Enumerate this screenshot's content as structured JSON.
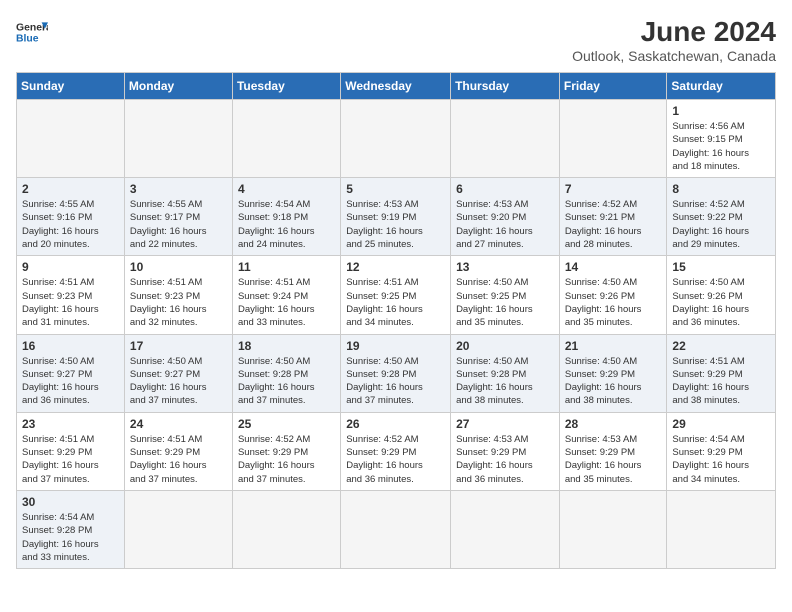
{
  "header": {
    "logo_general": "General",
    "logo_blue": "Blue",
    "month_year": "June 2024",
    "location": "Outlook, Saskatchewan, Canada"
  },
  "columns": [
    "Sunday",
    "Monday",
    "Tuesday",
    "Wednesday",
    "Thursday",
    "Friday",
    "Saturday"
  ],
  "weeks": [
    {
      "days": [
        {
          "num": "",
          "info": "",
          "empty": true
        },
        {
          "num": "",
          "info": "",
          "empty": true
        },
        {
          "num": "",
          "info": "",
          "empty": true
        },
        {
          "num": "",
          "info": "",
          "empty": true
        },
        {
          "num": "",
          "info": "",
          "empty": true
        },
        {
          "num": "",
          "info": "",
          "empty": true
        },
        {
          "num": "1",
          "info": "Sunrise: 4:56 AM\nSunset: 9:15 PM\nDaylight: 16 hours\nand 18 minutes.",
          "empty": false
        }
      ]
    },
    {
      "days": [
        {
          "num": "2",
          "info": "Sunrise: 4:55 AM\nSunset: 9:16 PM\nDaylight: 16 hours\nand 20 minutes.",
          "empty": false
        },
        {
          "num": "3",
          "info": "Sunrise: 4:55 AM\nSunset: 9:17 PM\nDaylight: 16 hours\nand 22 minutes.",
          "empty": false
        },
        {
          "num": "4",
          "info": "Sunrise: 4:54 AM\nSunset: 9:18 PM\nDaylight: 16 hours\nand 24 minutes.",
          "empty": false
        },
        {
          "num": "5",
          "info": "Sunrise: 4:53 AM\nSunset: 9:19 PM\nDaylight: 16 hours\nand 25 minutes.",
          "empty": false
        },
        {
          "num": "6",
          "info": "Sunrise: 4:53 AM\nSunset: 9:20 PM\nDaylight: 16 hours\nand 27 minutes.",
          "empty": false
        },
        {
          "num": "7",
          "info": "Sunrise: 4:52 AM\nSunset: 9:21 PM\nDaylight: 16 hours\nand 28 minutes.",
          "empty": false
        },
        {
          "num": "8",
          "info": "Sunrise: 4:52 AM\nSunset: 9:22 PM\nDaylight: 16 hours\nand 29 minutes.",
          "empty": false
        }
      ]
    },
    {
      "days": [
        {
          "num": "9",
          "info": "Sunrise: 4:51 AM\nSunset: 9:23 PM\nDaylight: 16 hours\nand 31 minutes.",
          "empty": false
        },
        {
          "num": "10",
          "info": "Sunrise: 4:51 AM\nSunset: 9:23 PM\nDaylight: 16 hours\nand 32 minutes.",
          "empty": false
        },
        {
          "num": "11",
          "info": "Sunrise: 4:51 AM\nSunset: 9:24 PM\nDaylight: 16 hours\nand 33 minutes.",
          "empty": false
        },
        {
          "num": "12",
          "info": "Sunrise: 4:51 AM\nSunset: 9:25 PM\nDaylight: 16 hours\nand 34 minutes.",
          "empty": false
        },
        {
          "num": "13",
          "info": "Sunrise: 4:50 AM\nSunset: 9:25 PM\nDaylight: 16 hours\nand 35 minutes.",
          "empty": false
        },
        {
          "num": "14",
          "info": "Sunrise: 4:50 AM\nSunset: 9:26 PM\nDaylight: 16 hours\nand 35 minutes.",
          "empty": false
        },
        {
          "num": "15",
          "info": "Sunrise: 4:50 AM\nSunset: 9:26 PM\nDaylight: 16 hours\nand 36 minutes.",
          "empty": false
        }
      ]
    },
    {
      "days": [
        {
          "num": "16",
          "info": "Sunrise: 4:50 AM\nSunset: 9:27 PM\nDaylight: 16 hours\nand 36 minutes.",
          "empty": false
        },
        {
          "num": "17",
          "info": "Sunrise: 4:50 AM\nSunset: 9:27 PM\nDaylight: 16 hours\nand 37 minutes.",
          "empty": false
        },
        {
          "num": "18",
          "info": "Sunrise: 4:50 AM\nSunset: 9:28 PM\nDaylight: 16 hours\nand 37 minutes.",
          "empty": false
        },
        {
          "num": "19",
          "info": "Sunrise: 4:50 AM\nSunset: 9:28 PM\nDaylight: 16 hours\nand 37 minutes.",
          "empty": false
        },
        {
          "num": "20",
          "info": "Sunrise: 4:50 AM\nSunset: 9:28 PM\nDaylight: 16 hours\nand 38 minutes.",
          "empty": false
        },
        {
          "num": "21",
          "info": "Sunrise: 4:50 AM\nSunset: 9:29 PM\nDaylight: 16 hours\nand 38 minutes.",
          "empty": false
        },
        {
          "num": "22",
          "info": "Sunrise: 4:51 AM\nSunset: 9:29 PM\nDaylight: 16 hours\nand 38 minutes.",
          "empty": false
        }
      ]
    },
    {
      "days": [
        {
          "num": "23",
          "info": "Sunrise: 4:51 AM\nSunset: 9:29 PM\nDaylight: 16 hours\nand 37 minutes.",
          "empty": false
        },
        {
          "num": "24",
          "info": "Sunrise: 4:51 AM\nSunset: 9:29 PM\nDaylight: 16 hours\nand 37 minutes.",
          "empty": false
        },
        {
          "num": "25",
          "info": "Sunrise: 4:52 AM\nSunset: 9:29 PM\nDaylight: 16 hours\nand 37 minutes.",
          "empty": false
        },
        {
          "num": "26",
          "info": "Sunrise: 4:52 AM\nSunset: 9:29 PM\nDaylight: 16 hours\nand 36 minutes.",
          "empty": false
        },
        {
          "num": "27",
          "info": "Sunrise: 4:53 AM\nSunset: 9:29 PM\nDaylight: 16 hours\nand 36 minutes.",
          "empty": false
        },
        {
          "num": "28",
          "info": "Sunrise: 4:53 AM\nSunset: 9:29 PM\nDaylight: 16 hours\nand 35 minutes.",
          "empty": false
        },
        {
          "num": "29",
          "info": "Sunrise: 4:54 AM\nSunset: 9:29 PM\nDaylight: 16 hours\nand 34 minutes.",
          "empty": false
        }
      ]
    },
    {
      "days": [
        {
          "num": "30",
          "info": "Sunrise: 4:54 AM\nSunset: 9:28 PM\nDaylight: 16 hours\nand 33 minutes.",
          "empty": false
        },
        {
          "num": "",
          "info": "",
          "empty": true
        },
        {
          "num": "",
          "info": "",
          "empty": true
        },
        {
          "num": "",
          "info": "",
          "empty": true
        },
        {
          "num": "",
          "info": "",
          "empty": true
        },
        {
          "num": "",
          "info": "",
          "empty": true
        },
        {
          "num": "",
          "info": "",
          "empty": true
        }
      ]
    }
  ]
}
